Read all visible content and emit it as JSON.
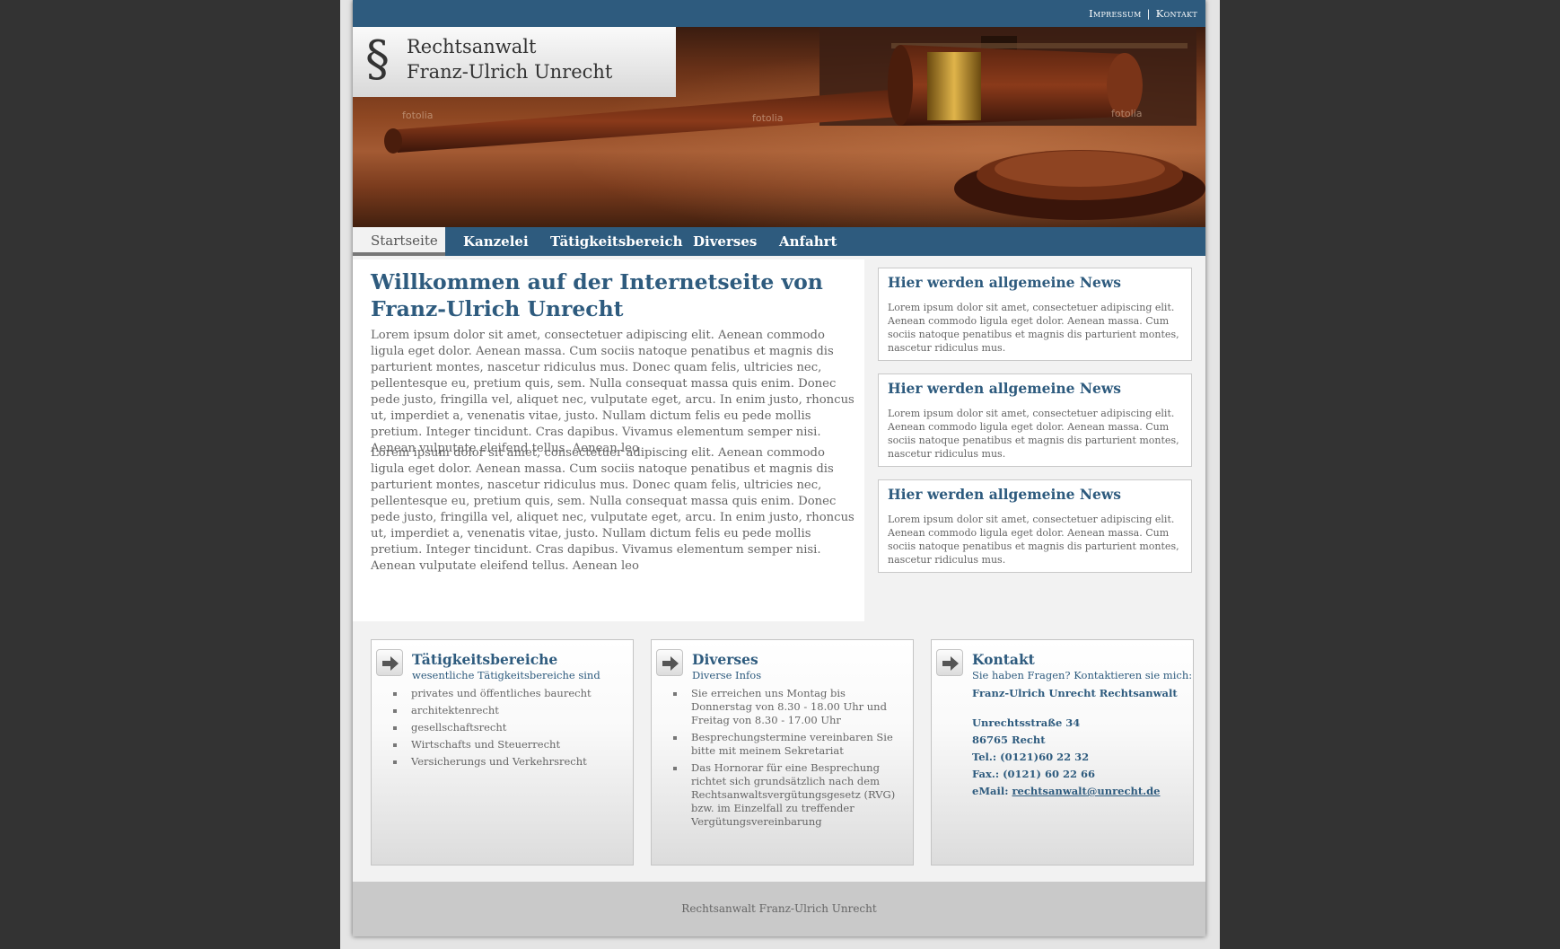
{
  "top_links": {
    "impressum": "Impressum",
    "separator": "|",
    "kontakt": "Kontakt"
  },
  "logo": {
    "symbol": "§",
    "line1": "Rechtsanwalt",
    "line2": "Franz-Ulrich Unrecht"
  },
  "banner": {
    "watermark1": "fotolia",
    "watermark2": "fotolia",
    "watermark3": "fotolia"
  },
  "nav": {
    "items": [
      "Startseite",
      "Kanzelei",
      "Tätigkeitsbereich",
      "Diverses",
      "Anfahrt"
    ],
    "active": "Startseite"
  },
  "main": {
    "title": "Willkommen auf der Internetseite von Franz-Ulrich Unrecht",
    "paragraph1": "Lorem ipsum dolor sit amet, consectetuer adipiscing elit. Aenean commodo ligula eget dolor. Aenean massa. Cum sociis natoque penatibus et magnis dis parturient montes, nascetur ridiculus mus. Donec quam felis, ultricies nec, pellentesque eu, pretium quis, sem. Nulla consequat massa quis enim. Donec pede justo, fringilla vel, aliquet nec, vulputate eget, arcu. In enim justo, rhoncus ut, imperdiet a, venenatis vitae, justo. Nullam dictum felis eu pede mollis pretium. Integer tincidunt. Cras dapibus. Vivamus elementum semper nisi. Aenean vulputate eleifend tellus. Aenean leo",
    "paragraph2": "Lorem ipsum dolor sit amet, consectetuer adipiscing elit. Aenean commodo ligula eget dolor. Aenean massa. Cum sociis natoque penatibus et magnis dis parturient montes, nascetur ridiculus mus. Donec quam felis, ultricies nec, pellentesque eu, pretium quis, sem. Nulla consequat massa quis enim. Donec pede justo, fringilla vel, aliquet nec, vulputate eget, arcu. In enim justo, rhoncus ut, imperdiet a, venenatis vitae, justo. Nullam dictum felis eu pede mollis pretium. Integer tincidunt. Cras dapibus. Vivamus elementum semper nisi. Aenean vulputate eleifend tellus. Aenean leo"
  },
  "news": [
    {
      "title": "Hier werden allgemeine News",
      "text": "Lorem ipsum dolor sit amet, consectetuer adipiscing elit. Aenean commodo ligula eget dolor. Aenean massa. Cum sociis natoque penatibus et magnis dis parturient montes, nascetur ridiculus mus."
    },
    {
      "title": "Hier werden allgemeine News",
      "text": "Lorem ipsum dolor sit amet, consectetuer adipiscing elit. Aenean commodo ligula eget dolor. Aenean massa. Cum sociis natoque penatibus et magnis dis parturient montes, nascetur ridiculus mus."
    },
    {
      "title": "Hier werden allgemeine News",
      "text": "Lorem ipsum dolor sit amet, consectetuer adipiscing elit. Aenean commodo ligula eget dolor. Aenean massa. Cum sociis natoque penatibus et magnis dis parturient montes, nascetur ridiculus mus."
    }
  ],
  "boxes": {
    "taetigkeit": {
      "title": "Tätigkeitsbereiche",
      "subtitle": "wesentliche Tätigkeitsbereiche sind",
      "items": [
        "privates und öffentliches baurecht",
        "architektenrecht",
        "gesellschaftsrecht",
        "Wirtschafts und Steuerrecht",
        "Versicherungs und Verkehrsrecht"
      ]
    },
    "diverses": {
      "title": "Diverses",
      "subtitle": "Diverse Infos",
      "items": [
        "Sie erreichen uns Montag bis Donnerstag von 8.30 - 18.00 Uhr und Freitag von 8.30 - 17.00 Uhr",
        "Besprechungstermine vereinbaren Sie bitte mit meinem Sekretariat",
        "Das Hornorar für eine Besprechung richtet sich grundsätzlich nach dem Rechtsanwaltsvergütungsgesetz (RVG) bzw. im Einzelfall zu treffender Vergütungsvereinbarung"
      ]
    },
    "kontakt": {
      "title": "Kontakt",
      "subtitle": "Sie haben Fragen? Kontaktieren sie mich:",
      "name": "Franz-Ulrich Unrecht Rechtsanwalt",
      "street": "Unrechtsstraße 34",
      "city": "86765 Recht",
      "tel": "Tel.: (0121)60 22 32",
      "fax": "Fax.: (0121) 60 22 66",
      "email_label": "eMail: ",
      "email": "rechtsanwalt@unrecht.de"
    }
  },
  "footer": {
    "text": "Rechtsanwalt Franz-Ulrich Unrecht"
  },
  "colors": {
    "brand_blue": "#2e5b7e",
    "page_bg": "#333333",
    "content_bg": "#f2f2f2"
  },
  "icons": {
    "arrow": "arrow-right-icon"
  }
}
